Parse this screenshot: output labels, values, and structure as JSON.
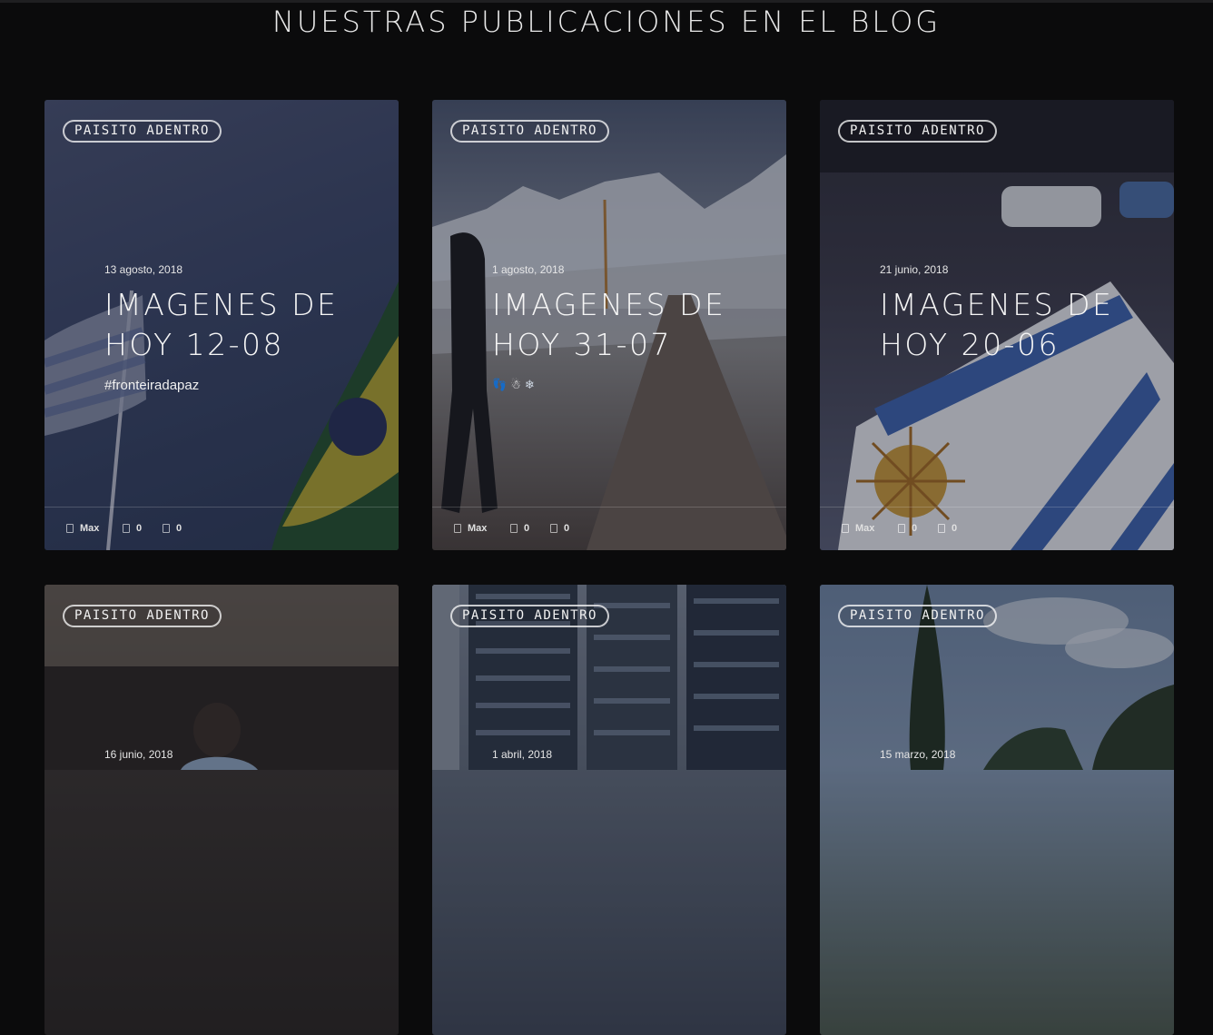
{
  "section": {
    "title": "NUESTRAS PUBLICACIONES EN EL BLOG"
  },
  "posts": [
    {
      "category": "PAISITO ADENTRO",
      "date": "13 agosto, 2018",
      "title": "IMAGENES DE HOY 12-08",
      "excerpt": "#fronteiradapaz",
      "author": "Max",
      "likes": "0",
      "comments": "0",
      "image": "flags-uruguay-brazil"
    },
    {
      "category": "PAISITO ADENTRO",
      "date": "1 agosto, 2018",
      "title": "IMAGENES DE HOY 31-07",
      "excerpt_icons": [
        "👣",
        "☃",
        "❄"
      ],
      "author": "Max",
      "likes": "0",
      "comments": "0",
      "image": "snowy-mountain-road"
    },
    {
      "category": "PAISITO ADENTRO",
      "date": "21 junio, 2018",
      "title": "IMAGENES DE HOY 20-06",
      "author": "Max",
      "likes": "0",
      "comments": "0",
      "image": "uruguay-flag-street"
    },
    {
      "category": "PAISITO ADENTRO",
      "date": "16 junio, 2018",
      "image": "vintage-football-photo"
    },
    {
      "category": "PAISITO ADENTRO",
      "date": "1 abril, 2018",
      "image": "apartment-building"
    },
    {
      "category": "PAISITO ADENTRO",
      "date": "15 marzo, 2018",
      "image": "cypress-trees-sky"
    }
  ],
  "colors": {
    "background": "#0b0b0c",
    "text": "#ffffff",
    "tag_border": "#d9d9d9"
  }
}
